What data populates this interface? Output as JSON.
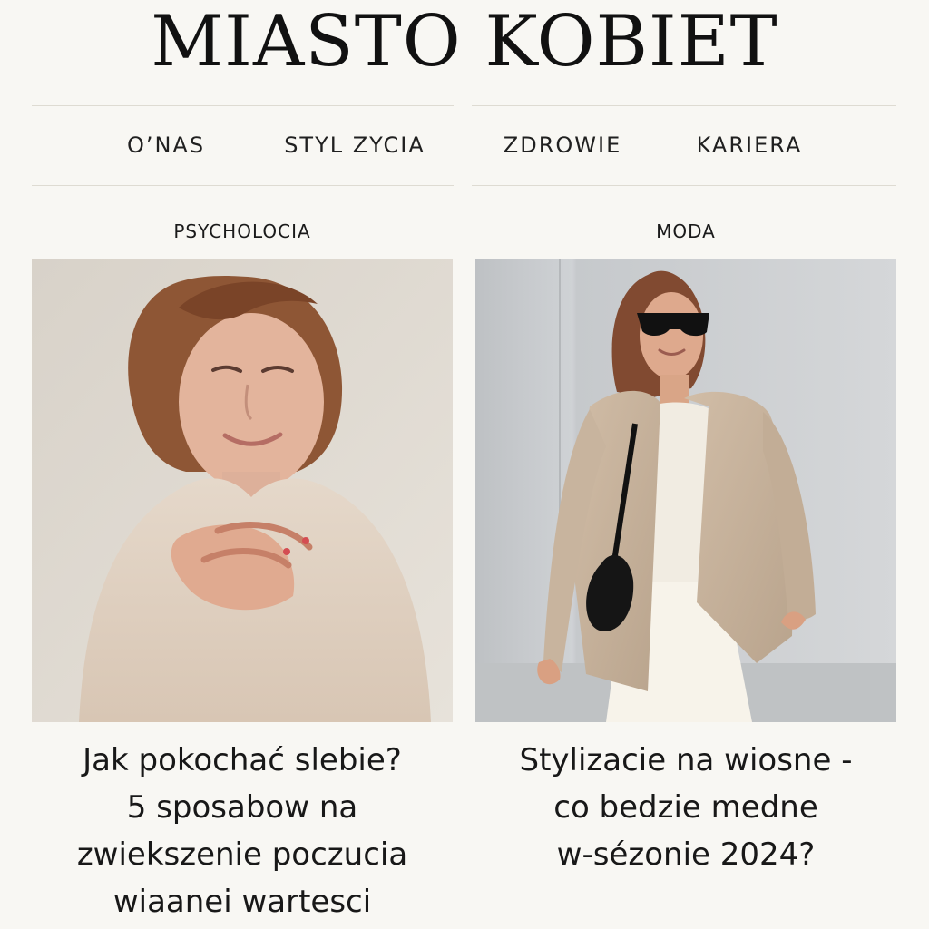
{
  "site": {
    "title": "MIASTO KOBIET"
  },
  "nav": {
    "items": [
      {
        "label": "O’NAS"
      },
      {
        "label": "STYL ZYCIA"
      },
      {
        "label": "ZDROWIE"
      },
      {
        "label": "KARIERA"
      }
    ]
  },
  "articles": [
    {
      "category": "PSYCHOLOCIA",
      "headline_lines": [
        "Jak pokochać slebie?",
        "5 sposabow na",
        "zwiekszenie poczucia",
        "wiaanei wartesci"
      ]
    },
    {
      "category": "MODA",
      "headline_lines": [
        "Stylizacie na wiosne -",
        "co bedzie medne",
        "w-sézonie 2024?"
      ]
    }
  ],
  "colors": {
    "background": "#f8f7f3",
    "text": "#161616",
    "rule": "#dedbd2",
    "sweater": "#dfcfc0",
    "blazer": "#c7b39d"
  }
}
